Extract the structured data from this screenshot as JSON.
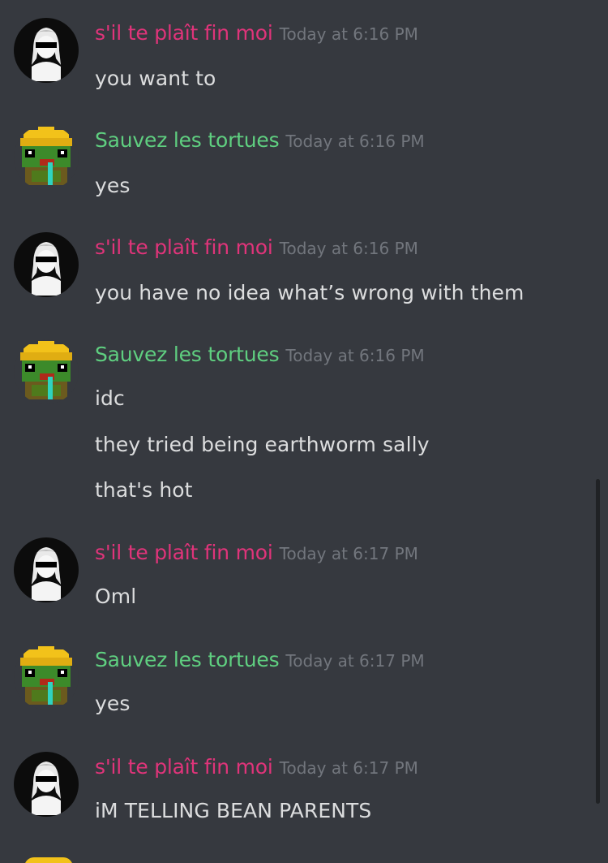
{
  "colors": {
    "background": "#36393f",
    "user_a": "#e0347a",
    "user_b": "#5fcf80",
    "timestamp": "#72767d",
    "text": "#dcddde"
  },
  "messages": [
    {
      "user": "s'il te plaît fin moi",
      "avatar": "anime-girl-avatar",
      "timestamp": "Today at 6:16 PM",
      "lines": [
        "you want to"
      ]
    },
    {
      "user": "Sauvez les tortues",
      "avatar": "pixel-turtle-avatar",
      "timestamp": "Today at 6:16 PM",
      "lines": [
        "yes"
      ]
    },
    {
      "user": "s'il te plaît fin moi",
      "avatar": "anime-girl-avatar",
      "timestamp": "Today at 6:16 PM",
      "lines": [
        "you have no idea what’s wrong with them"
      ]
    },
    {
      "user": "Sauvez les tortues",
      "avatar": "pixel-turtle-avatar",
      "timestamp": "Today at 6:16 PM",
      "lines": [
        "idc",
        "they tried being earthworm sally",
        "that's hot"
      ]
    },
    {
      "user": "s'il te plaît fin moi",
      "avatar": "anime-girl-avatar",
      "timestamp": "Today at 6:17 PM",
      "lines": [
        "Oml"
      ]
    },
    {
      "user": "Sauvez les tortues",
      "avatar": "pixel-turtle-avatar",
      "timestamp": "Today at 6:17 PM",
      "lines": [
        "yes"
      ]
    },
    {
      "user": "s'il te plaît fin moi",
      "avatar": "anime-girl-avatar",
      "timestamp": "Today at 6:17 PM",
      "lines": [
        "iM TELLING BEAN PARENTS"
      ]
    }
  ]
}
